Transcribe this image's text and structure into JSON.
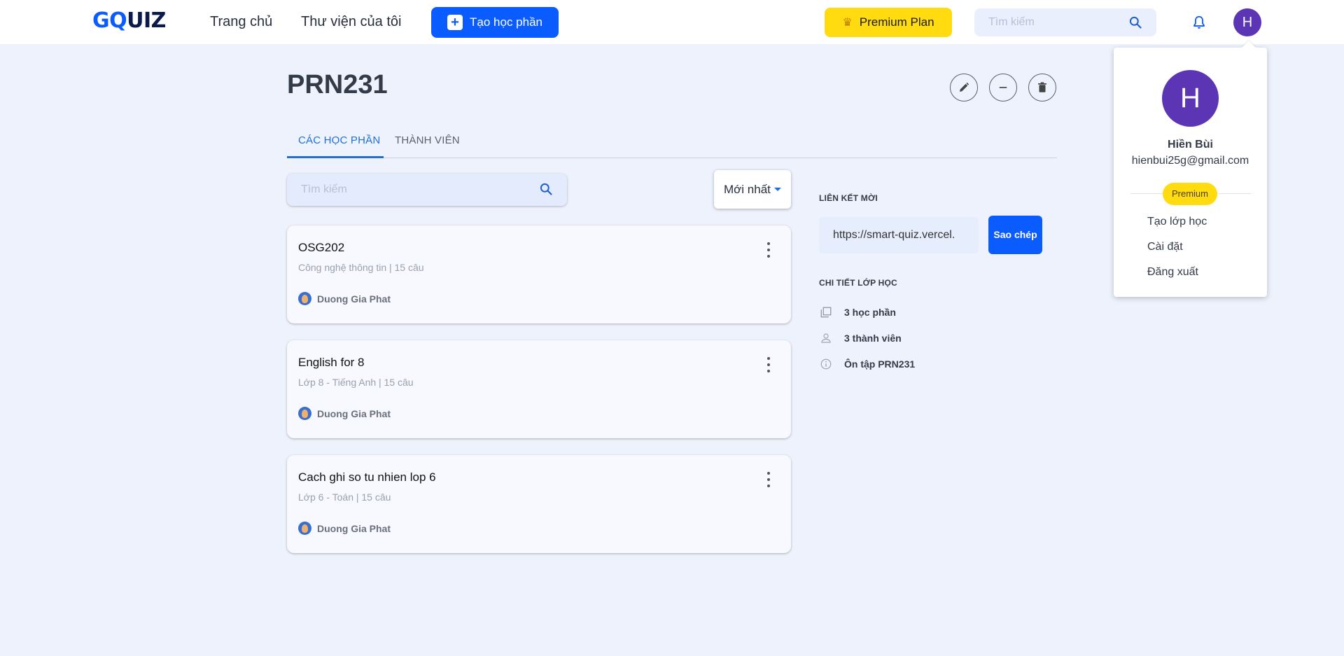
{
  "header": {
    "logo": {
      "g": "G",
      "q": "Q",
      "rest": "UIZ"
    },
    "nav": {
      "home": "Trang chủ",
      "library": "Thư viện của tôi"
    },
    "create_button": "Tạo học phần",
    "premium_button": "Premium Plan",
    "search_placeholder": "Tìm kiếm",
    "avatar_initial": "H"
  },
  "page": {
    "title": "PRN231",
    "tabs": [
      {
        "label": "CÁC HỌC PHẦN",
        "active": true
      },
      {
        "label": "THÀNH VIÊN",
        "active": false
      }
    ],
    "search_placeholder": "Tìm kiếm",
    "sort_selected": "Mới nhất"
  },
  "study_sets": [
    {
      "title": "OSG202",
      "subtitle": "Công nghệ thông tin | 15 câu",
      "author": "Duong Gia Phat"
    },
    {
      "title": "English for 8",
      "subtitle": "Lớp 8 - Tiếng Anh | 15 câu",
      "author": "Duong Gia Phat"
    },
    {
      "title": "Cach ghi so tu nhien lop 6",
      "subtitle": "Lớp 6 - Toán | 15 câu",
      "author": "Duong Gia Phat"
    }
  ],
  "sidebar": {
    "invite_label": "LIÊN KẾT MỜI",
    "invite_link": "https://smart-quiz.vercel.",
    "copy_button": "Sao chép",
    "details_label": "CHI TIẾT LỚP HỌC",
    "details": {
      "sets": "3 học phần",
      "members": "3 thành viên",
      "description": "Ôn tập PRN231"
    }
  },
  "account_menu": {
    "avatar_initial": "H",
    "name": "Hiền Bùi",
    "email": "hienbui25g@gmail.com",
    "badge": "Premium",
    "items": [
      "Tạo lớp học",
      "Cài đặt",
      "Đăng xuất"
    ]
  },
  "colors": {
    "primary": "#0b5cff",
    "premium": "#ffdb0f",
    "avatar": "#5b35b3",
    "background": "#edf2fc",
    "tab_active": "#1f6fd8"
  },
  "icons": {
    "search": "search-icon",
    "bell": "bell-icon",
    "edit": "pencil-icon",
    "minus": "minus-circle-icon",
    "trash": "trash-icon",
    "more": "more-vertical-icon",
    "sets": "stacked-cards-icon",
    "members": "person-icon",
    "info": "info-icon",
    "crown": "crown-icon",
    "plus": "plus-icon"
  }
}
